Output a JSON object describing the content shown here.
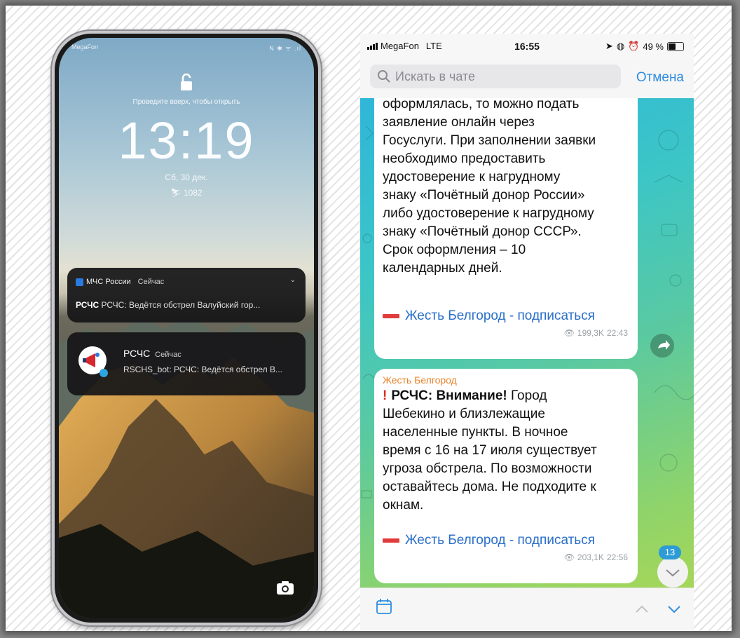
{
  "lockscreen": {
    "status": {
      "carrier": "MegaFon",
      "icons": "N ✱ ᯤ .ıl"
    },
    "swipe_hint": "Проведите вверх, чтобы открыть",
    "time": "13:19",
    "date": "Сб, 30 дек.",
    "steps": "1082",
    "notifications": [
      {
        "app": "МЧС России",
        "time": "Сейчас",
        "sender": "РСЧС",
        "text": "РСЧС: Ведётся обстрел Валуйский гор..."
      },
      {
        "title": "РСЧС",
        "time": "Сейчас",
        "text": "RSCHS_bot: РСЧС: Ведётся обстрел В..."
      }
    ]
  },
  "chat_screen": {
    "status": {
      "carrier": "MegaFon",
      "network": "LTE",
      "time": "16:55",
      "battery": "49 %"
    },
    "search": {
      "placeholder": "Искать в чате",
      "cancel": "Отмена"
    },
    "messages": [
      {
        "lines": [
          "оформлялась, то можно подать",
          "заявление онлайн через",
          "Госуслуги. При заполнении заявки",
          "необходимо предоставить",
          "удостоверение к нагрудному",
          "знаку «Почётный донор России»",
          "либо удостоверение к нагрудному",
          "знаку «Почётный донор СССР».",
          "Срок оформления – 10",
          "календарных дней."
        ],
        "link": "Жесть Белгород - подписаться",
        "views": "199,3K",
        "time": "22:43"
      },
      {
        "sender": "Жесть Белгород",
        "bold": "РСЧС: Внимание!",
        "first_tail": " Город",
        "lines": [
          "Шебекино и близлежащие",
          "населенные пункты. В ночное",
          "время с 16 на 17 июля существует",
          "угроза обстрела. По возможности",
          "оставайтесь дома. Не подходите к",
          "окнам."
        ],
        "link": "Жесть Белгород - подписаться",
        "views": "203,1K",
        "time": "22:56"
      }
    ],
    "unread_count": "13",
    "colors": {
      "accent": "#2f8de0",
      "link": "#2a6fc9",
      "sender": "#e8842c",
      "alert": "#e0281c"
    }
  }
}
